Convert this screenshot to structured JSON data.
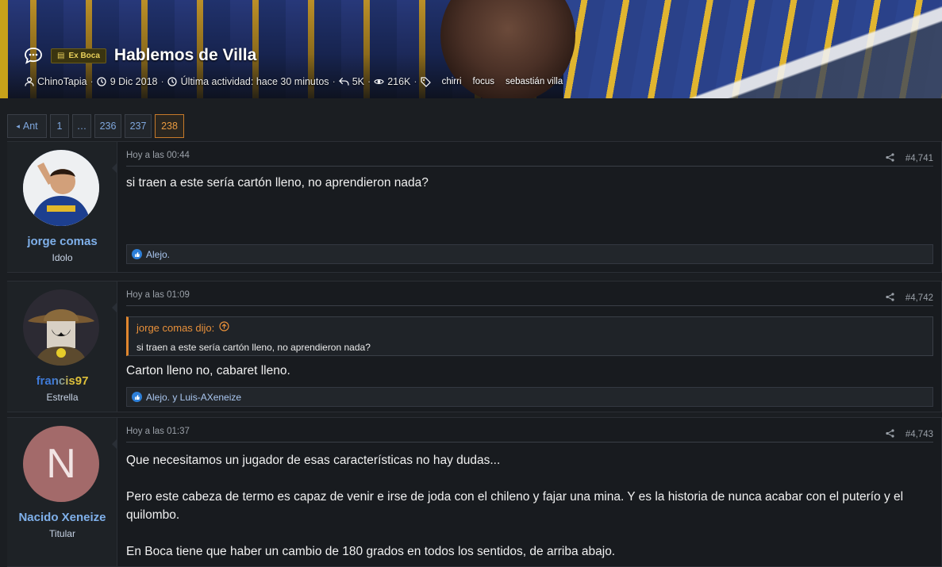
{
  "thread": {
    "prefix": "Ex Boca",
    "title": "Hablemos de Villa",
    "author": "ChinoTapia",
    "start_date": "9 Dic 2018",
    "last_activity": "Última actividad: hace 30 minutos",
    "replies": "5K",
    "views": "216K",
    "tags": [
      "chirri",
      "focus",
      "sebastián villa"
    ]
  },
  "pager": {
    "prev": "Ant",
    "pages": [
      "1",
      "…",
      "236",
      "237",
      "238"
    ],
    "current": "238"
  },
  "posts": [
    {
      "user": "jorge comas",
      "user_title": "Idolo",
      "time": "Hoy a las 00:44",
      "num": "#4,741",
      "body": [
        "si traen a este sería cartón lleno, no aprendieron nada?"
      ],
      "reactions": "Alejo.",
      "name_color": "#7fb0ea"
    },
    {
      "user": "francis97",
      "user_title": "Estrella",
      "time": "Hoy a las 01:09",
      "num": "#4,742",
      "quote_author": "jorge comas dijo:",
      "quote_text": "si traen a este sería cartón lleno, no aprendieron nada?",
      "body": [
        "Carton lleno no, cabaret lleno."
      ],
      "reactions": "Alejo. y Luis-AXeneize",
      "name_color_a": "#3f7bd9",
      "name_color_b": "#e0c23a"
    },
    {
      "user": "Nacido Xeneize",
      "user_title": "Titular",
      "avatar_letter": "N",
      "avatar_color": "#a36a6a",
      "time": "Hoy a las 01:37",
      "num": "#4,743",
      "body": [
        "Que necesitamos un jugador de esas características no hay dudas...",
        "Pero este cabeza de termo es capaz de venir e irse de joda con el chileno y fajar una mina. Y es la historia de nunca acabar con el puterío y el quilombo.",
        "En Boca tiene que haber un cambio de 180 grados en todos los sentidos, de arriba abajo."
      ],
      "name_color": "#7fb0ea"
    }
  ]
}
